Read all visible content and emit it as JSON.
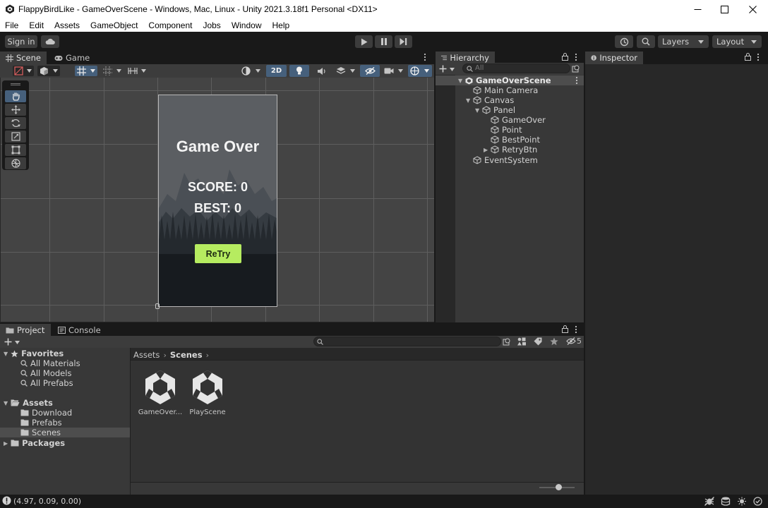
{
  "window": {
    "title": "FlappyBirdLike - GameOverScene - Windows, Mac, Linux - Unity 2021.3.18f1 Personal <DX11>"
  },
  "menu": [
    "File",
    "Edit",
    "Assets",
    "GameObject",
    "Component",
    "Jobs",
    "Window",
    "Help"
  ],
  "toolbar": {
    "sign_in": "Sign in",
    "layers": "Layers",
    "layout": "Layout"
  },
  "scene_panel": {
    "tabs": [
      "Scene",
      "Game"
    ],
    "toggle_2d": "2D"
  },
  "game_canvas": {
    "title": "Game Over",
    "score": "SCORE: 0",
    "best": "BEST: 0",
    "retry": "ReTry"
  },
  "hierarchy": {
    "tab": "Hierarchy",
    "search_placeholder": "All",
    "items": [
      {
        "label": "GameOverScene",
        "level": 0
      },
      {
        "label": "Main Camera",
        "level": 1
      },
      {
        "label": "Canvas",
        "level": 1
      },
      {
        "label": "Panel",
        "level": 2
      },
      {
        "label": "GameOver",
        "level": 3
      },
      {
        "label": "Point",
        "level": 3
      },
      {
        "label": "BestPoint",
        "level": 3
      },
      {
        "label": "RetryBtn",
        "level": 3
      },
      {
        "label": "EventSystem",
        "level": 1
      }
    ]
  },
  "inspector": {
    "tab": "Inspector"
  },
  "project": {
    "tabs": [
      "Project",
      "Console"
    ],
    "hidden_count": "5",
    "favorites": {
      "label": "Favorites",
      "items": [
        "All Materials",
        "All Models",
        "All Prefabs"
      ]
    },
    "assets": {
      "label": "Assets",
      "items": [
        "Download",
        "Prefabs",
        "Scenes"
      ]
    },
    "packages": "Packages",
    "breadcrumb": [
      "Assets",
      "Scenes"
    ],
    "files": [
      "GameOver...",
      "PlayScene"
    ]
  },
  "status": {
    "coords": "(4.97, 0.09, 0.00)"
  },
  "colors": {
    "accent_blue": "#46607c",
    "retry_green": "#b6ec60",
    "selected_row": "#4d4d4d"
  }
}
